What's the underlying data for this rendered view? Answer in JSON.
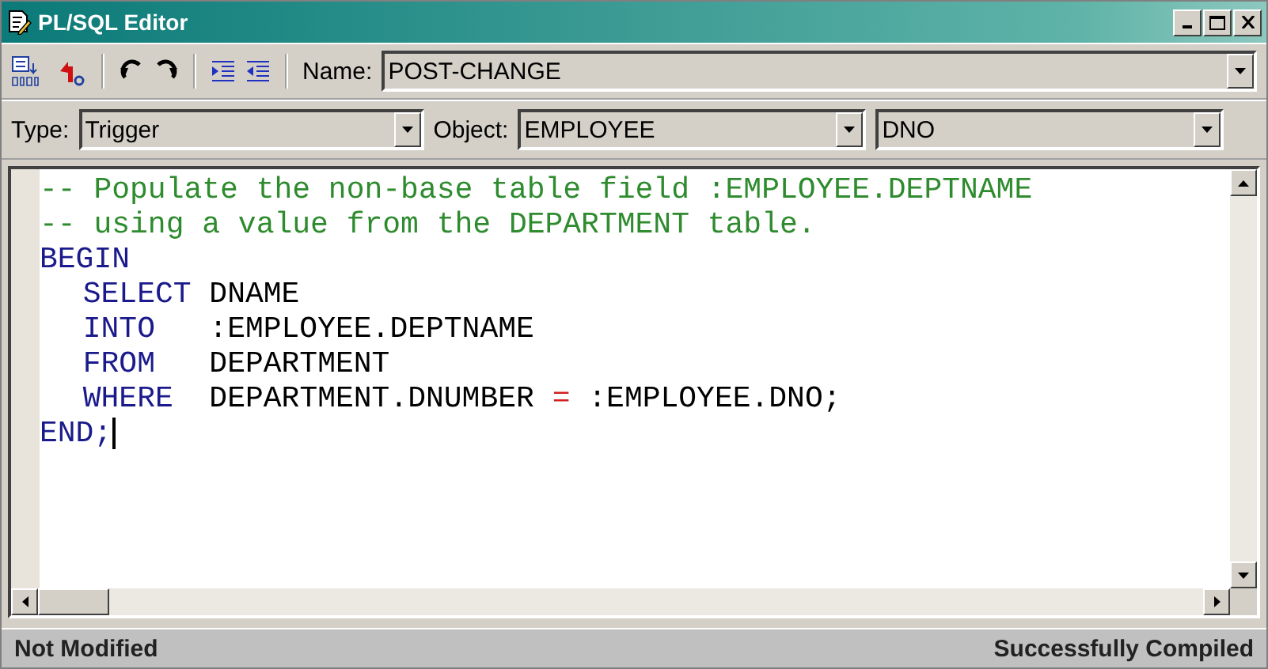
{
  "window": {
    "title": "PL/SQL Editor"
  },
  "toolbar": {
    "name_label": "Name:",
    "name_value": "POST-CHANGE"
  },
  "selectors": {
    "type_label": "Type:",
    "type_value": "Trigger",
    "object_label": "Object:",
    "object_value": "EMPLOYEE",
    "item_value": "DNO"
  },
  "code_lines": [
    {
      "indented": false,
      "tokens": [
        {
          "text": "-- Populate the non-base table field :EMPLOYEE.DEPTNAME",
          "kind": "comment"
        }
      ]
    },
    {
      "indented": false,
      "tokens": [
        {
          "text": "-- using a value from the DEPARTMENT table.",
          "kind": "comment"
        }
      ]
    },
    {
      "indented": false,
      "tokens": [
        {
          "text": "BEGIN",
          "kind": "keyword"
        }
      ]
    },
    {
      "indented": true,
      "tokens": [
        {
          "text": "SELECT",
          "kind": "keyword"
        },
        {
          "text": " DNAME",
          "kind": "plain"
        }
      ]
    },
    {
      "indented": true,
      "tokens": [
        {
          "text": "INTO",
          "kind": "keyword"
        },
        {
          "text": "   :EMPLOYEE.DEPTNAME",
          "kind": "plain"
        }
      ]
    },
    {
      "indented": true,
      "tokens": [
        {
          "text": "FROM",
          "kind": "keyword"
        },
        {
          "text": "   DEPARTMENT",
          "kind": "plain"
        }
      ]
    },
    {
      "indented": true,
      "tokens": [
        {
          "text": "WHERE",
          "kind": "keyword"
        },
        {
          "text": "  DEPARTMENT.DNUMBER ",
          "kind": "plain"
        },
        {
          "text": "=",
          "kind": "operator"
        },
        {
          "text": " :EMPLOYEE.DNO;",
          "kind": "plain"
        }
      ]
    },
    {
      "indented": false,
      "tokens": [
        {
          "text": "END;",
          "kind": "keyword"
        }
      ]
    }
  ],
  "status_bar": {
    "left": "Not Modified",
    "right": "Successfully Compiled"
  }
}
